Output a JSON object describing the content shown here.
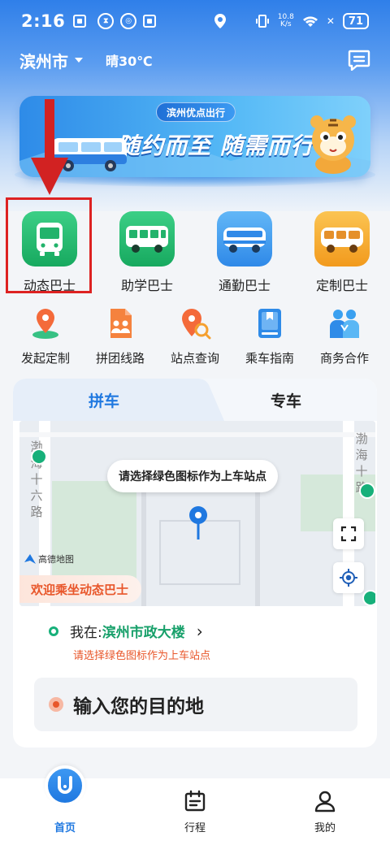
{
  "status_bar": {
    "time": "2:16",
    "net_speed_value": "10.8",
    "net_speed_unit": "K/s",
    "battery": "71"
  },
  "header": {
    "city": "滨州市",
    "weather": "晴30℃"
  },
  "banner": {
    "tag": "滨州优点出行",
    "slogan": "随约而至 随需而行"
  },
  "main_services": [
    {
      "label": "动态巴士",
      "color": "#22b36b"
    },
    {
      "label": "助学巴士",
      "color": "#22b36b"
    },
    {
      "label": "通勤巴士",
      "color": "#3d98f2"
    },
    {
      "label": "定制巴士",
      "color": "#f6a623"
    }
  ],
  "sub_services": [
    {
      "label": "发起定制",
      "icon": "location-pin-icon"
    },
    {
      "label": "拼团线路",
      "icon": "group-document-icon"
    },
    {
      "label": "站点查询",
      "icon": "station-search-icon"
    },
    {
      "label": "乘车指南",
      "icon": "guide-book-icon"
    },
    {
      "label": "商务合作",
      "icon": "business-people-icon"
    }
  ],
  "booking": {
    "tabs": [
      "拼车",
      "专车"
    ],
    "active_tab": "拼车",
    "map": {
      "callout": "请选择绿色图标作为上车站点",
      "road_left": [
        "渤",
        "海",
        "十",
        "六",
        "路"
      ],
      "road_right": [
        "渤",
        "海",
        "十",
        "路"
      ],
      "provider": "高德地图",
      "welcome": "欢迎乘坐动态巴士"
    },
    "location_prefix": "我在:",
    "location_name": "滨州市政大楼",
    "location_hint": "请选择绿色图标作为上车站点",
    "destination_placeholder": "输入您的目的地"
  },
  "bottom_nav": [
    {
      "label": "首页",
      "active": true
    },
    {
      "label": "行程",
      "active": false
    },
    {
      "label": "我的",
      "active": false
    }
  ],
  "colors": {
    "primary": "#1f78e0",
    "green": "#17b07a",
    "orange": "#e8562a",
    "annotation_red": "#d22222"
  }
}
